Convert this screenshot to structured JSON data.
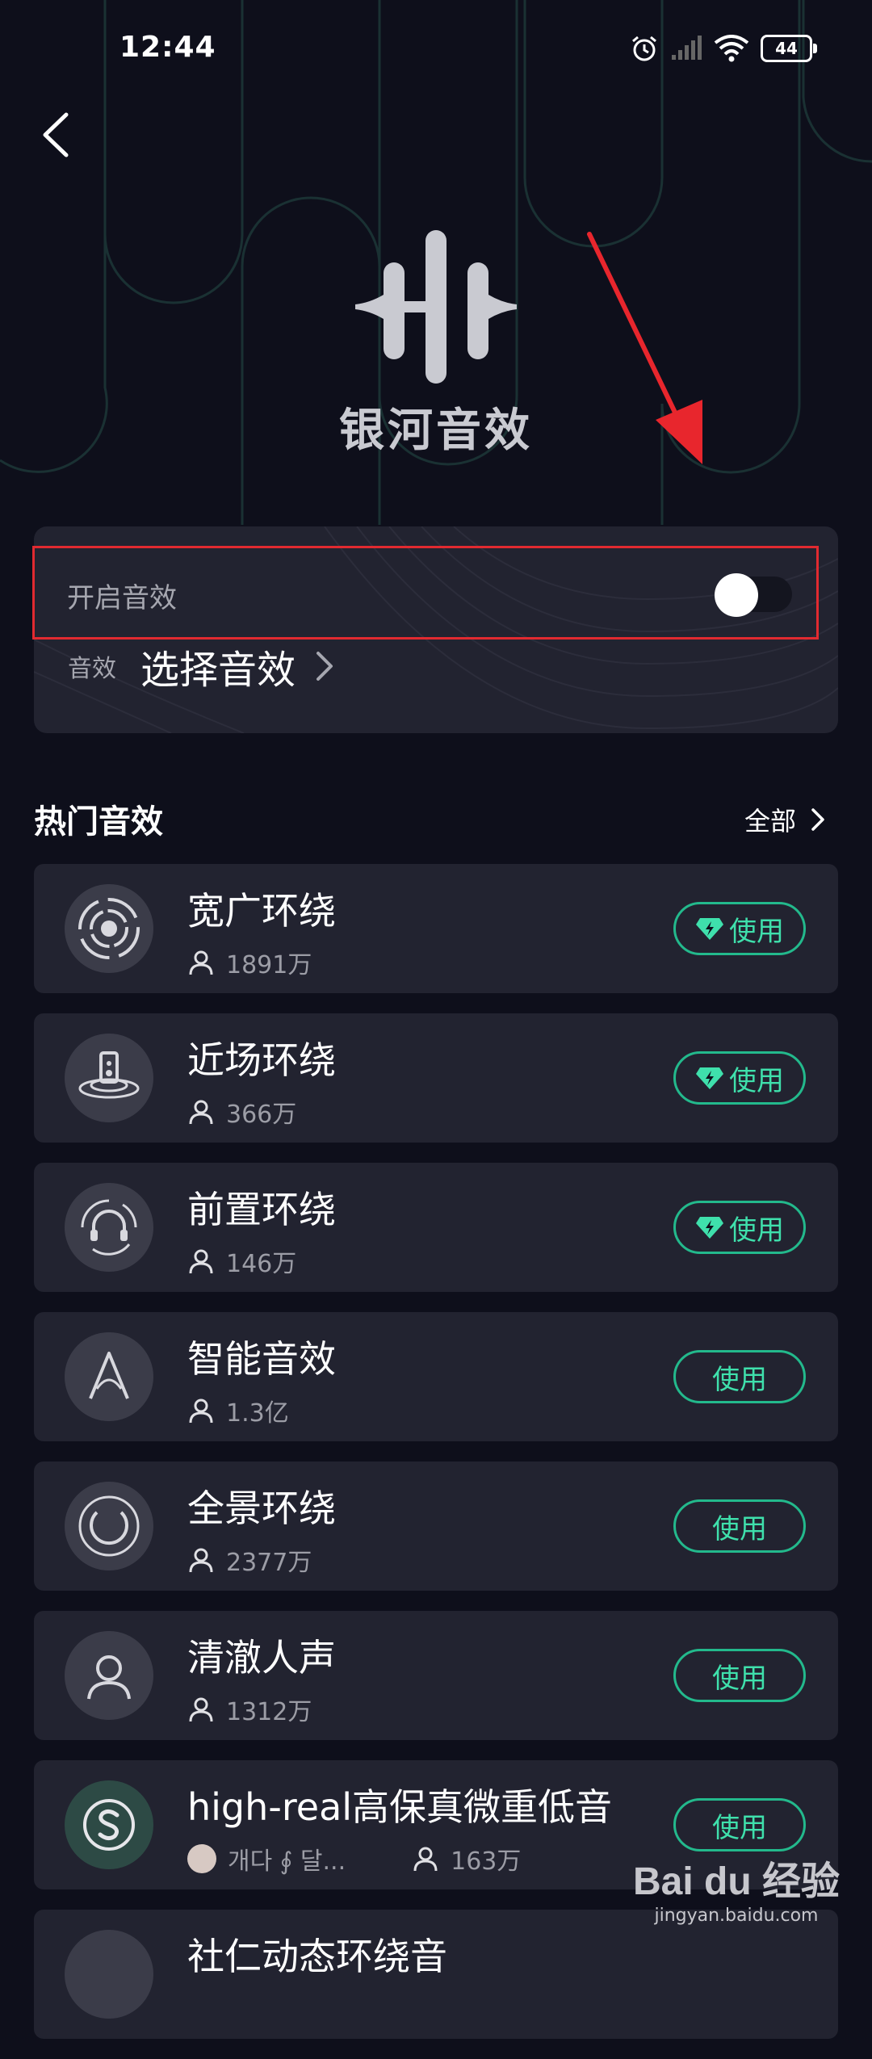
{
  "status": {
    "time": "12:44",
    "battery": "44"
  },
  "header": {
    "app_name": "银河音效"
  },
  "panel": {
    "toggle_label": "开启音效",
    "toggle_on": false,
    "select_prefix": "音效",
    "select_value": "选择音效"
  },
  "section": {
    "title": "热门音效",
    "all_label": "全部"
  },
  "items": [
    {
      "title": "宽广环绕",
      "users": "1891万",
      "button": "使用",
      "vip": true,
      "icon": "wide-surround-icon"
    },
    {
      "title": "近场环绕",
      "users": "366万",
      "button": "使用",
      "vip": true,
      "icon": "speaker-icon"
    },
    {
      "title": "前置环绕",
      "users": "146万",
      "button": "使用",
      "vip": true,
      "icon": "headphones-icon"
    },
    {
      "title": "智能音效",
      "users": "1.3亿",
      "button": "使用",
      "vip": false,
      "icon": "ai-letter-icon"
    },
    {
      "title": "全景环绕",
      "users": "2377万",
      "button": "使用",
      "vip": false,
      "icon": "panorama-icon"
    },
    {
      "title": "清澈人声",
      "users": "1312万",
      "button": "使用",
      "vip": false,
      "icon": "person-icon"
    },
    {
      "title": "high-real高保真微重低音",
      "author": "개다 ∮ 달...",
      "users": "163万",
      "button": "使用",
      "vip": false,
      "icon": "s-badge-icon"
    },
    {
      "title": "社仁动态环绕音"
    }
  ],
  "watermark": {
    "brand": "Bai du 经验",
    "url": "jingyan.baidu.com"
  },
  "colors": {
    "accent": "#3fe0ac",
    "highlight": "#e12a30",
    "background": "#0e0f1b",
    "card": "#222330"
  }
}
